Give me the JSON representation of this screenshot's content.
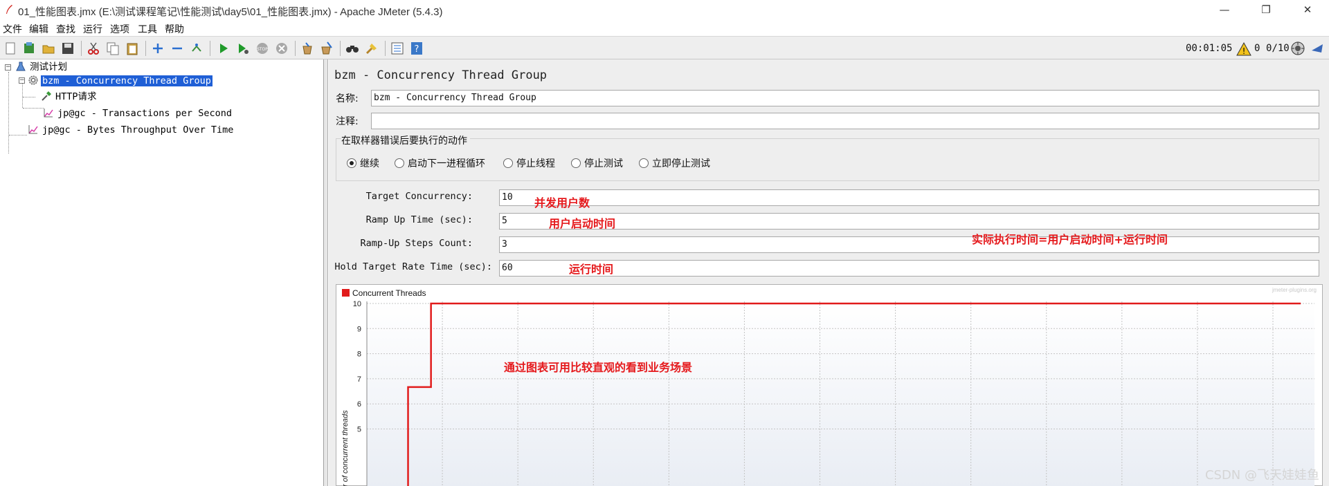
{
  "window": {
    "title": "01_性能图表.jmx (E:\\测试课程笔记\\性能测试\\day5\\01_性能图表.jmx) - Apache JMeter (5.4.3)",
    "minimize": "—",
    "restore": "❐",
    "close": "✕"
  },
  "menu": [
    "文件",
    "编辑",
    "查找",
    "运行",
    "选项",
    "工具",
    "帮助"
  ],
  "toolbar": {
    "elapsed": "00:01:05",
    "warning_count": "0",
    "threads": "0/10"
  },
  "tree": {
    "root": "测试计划",
    "thread_group": "bzm - Concurrency Thread Group",
    "http_request": "HTTP请求",
    "tps_listener": "jp@gc - Transactions per Second",
    "bytes_listener": "jp@gc - Bytes Throughput Over Time"
  },
  "panel": {
    "title": "bzm - Concurrency Thread Group",
    "name_label": "名称:",
    "name_value": "bzm - Concurrency Thread Group",
    "comment_label": "注释:",
    "comment_value": "",
    "error_group_legend": "在取样器错误后要执行的动作",
    "error_actions": [
      "继续",
      "启动下一进程循环",
      "停止线程",
      "停止测试",
      "立即停止测试"
    ],
    "error_action_selected": "继续",
    "params": {
      "target_concurrency_label": "Target Concurrency:",
      "target_concurrency_value": "10",
      "ramp_up_label": "Ramp Up Time (sec):",
      "ramp_up_value": "5",
      "steps_label": "Ramp-Up Steps Count:",
      "steps_value": "3",
      "hold_label": "Hold Target Rate Time (sec):",
      "hold_value": "60"
    }
  },
  "annotations": {
    "concurrency": "并发用户数",
    "ramp_up": "用户启动时间",
    "total_time": "实际执行时间=用户启动时间+运行时间",
    "hold": "运行时间",
    "chart_note": "通过图表可用比较直观的看到业务场景"
  },
  "chart_data": {
    "type": "line",
    "legend": "Concurrent Threads",
    "watermark": "jmeter-plugins.org",
    "ylabel": "r of concurrent threads",
    "y_ticks": [
      "10",
      "9",
      "8",
      "7",
      "6",
      "5"
    ],
    "ylim_visible": [
      4.2,
      10
    ],
    "series": [
      {
        "name": "Concurrent Threads",
        "color": "#e11b1b",
        "x": [
          0,
          0,
          1.67,
          1.67,
          65
        ],
        "values": [
          0,
          6.67,
          6.67,
          10,
          10
        ]
      }
    ],
    "xlim": [
      -3,
      66
    ]
  },
  "credit": "CSDN @飞天娃娃鱼"
}
